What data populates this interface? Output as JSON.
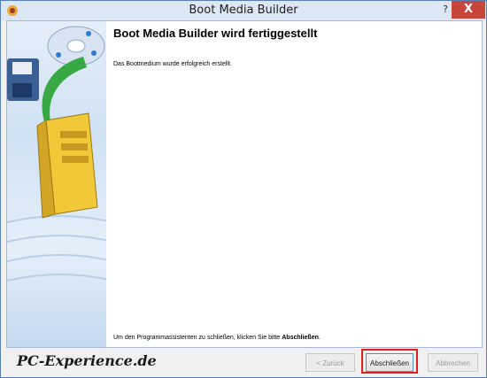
{
  "window": {
    "title": "Boot Media Builder",
    "help_label": "?",
    "close_label": "X",
    "app_icon": "app-icon"
  },
  "wizard": {
    "heading": "Boot Media Builder wird fertiggestellt",
    "message": "Das Bootmedium wurde erfolgreich erstellt.",
    "footer_prefix": "Um den Programmassistenten zu schließen, klicken Sie bitte ",
    "footer_bold": "Abschließen",
    "footer_suffix": ".",
    "sidebar_art": [
      "floppy-disk-icon",
      "cd-icon",
      "computer-tower-icon",
      "green-arrow-icon"
    ]
  },
  "buttons": {
    "back": "< Zurück",
    "finish": "Abschließen",
    "cancel": "Abbrechen"
  },
  "branding": {
    "watermark": "PC-Experience.de"
  },
  "colors": {
    "close_button": "#c7463c",
    "highlight": "#e11f1f",
    "title_bar": "#dbe7f5"
  }
}
